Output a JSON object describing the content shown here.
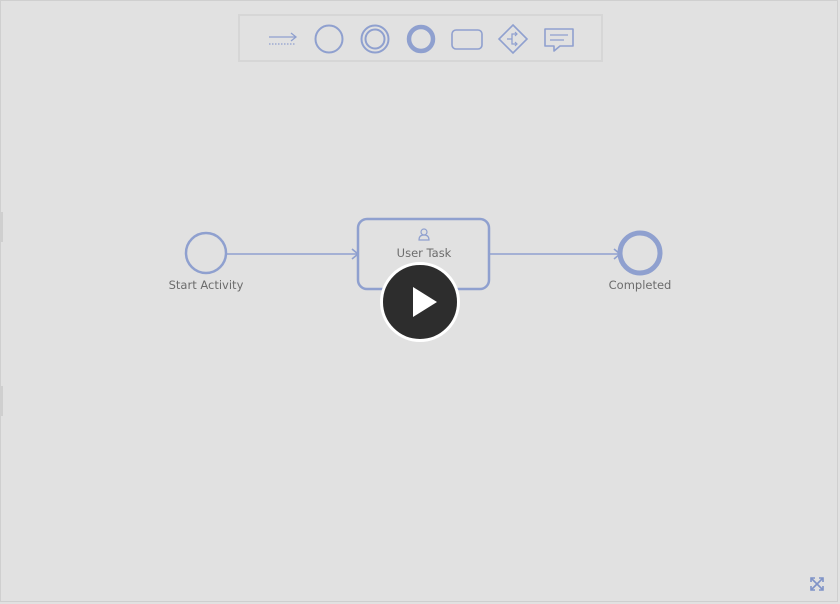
{
  "palette": {
    "tools": [
      {
        "name": "sequence-flow-tool",
        "icon": "connector-arrow-icon"
      },
      {
        "name": "start-event-tool",
        "icon": "start-event-circle-icon"
      },
      {
        "name": "intermediate-event-tool",
        "icon": "intermediate-event-double-circle-icon"
      },
      {
        "name": "end-event-tool",
        "icon": "end-event-thick-circle-icon"
      },
      {
        "name": "task-tool",
        "icon": "task-rectangle-icon"
      },
      {
        "name": "gateway-tool",
        "icon": "gateway-diamond-icon"
      },
      {
        "name": "annotation-tool",
        "icon": "speech-bubble-icon"
      }
    ]
  },
  "diagram": {
    "start_event": {
      "label": "Start Activity"
    },
    "user_task": {
      "label": "User Task",
      "icon": "user-icon"
    },
    "end_event": {
      "label": "Completed"
    }
  },
  "overlay": {
    "play_icon": "play-icon"
  },
  "footer": {
    "fullscreen_icon": "expand-icon"
  },
  "colors": {
    "background": "#e1e1e1",
    "shape_stroke": "#8fa0cf",
    "label_text": "#6c6c6c",
    "play_button": "#2d2d2d"
  }
}
